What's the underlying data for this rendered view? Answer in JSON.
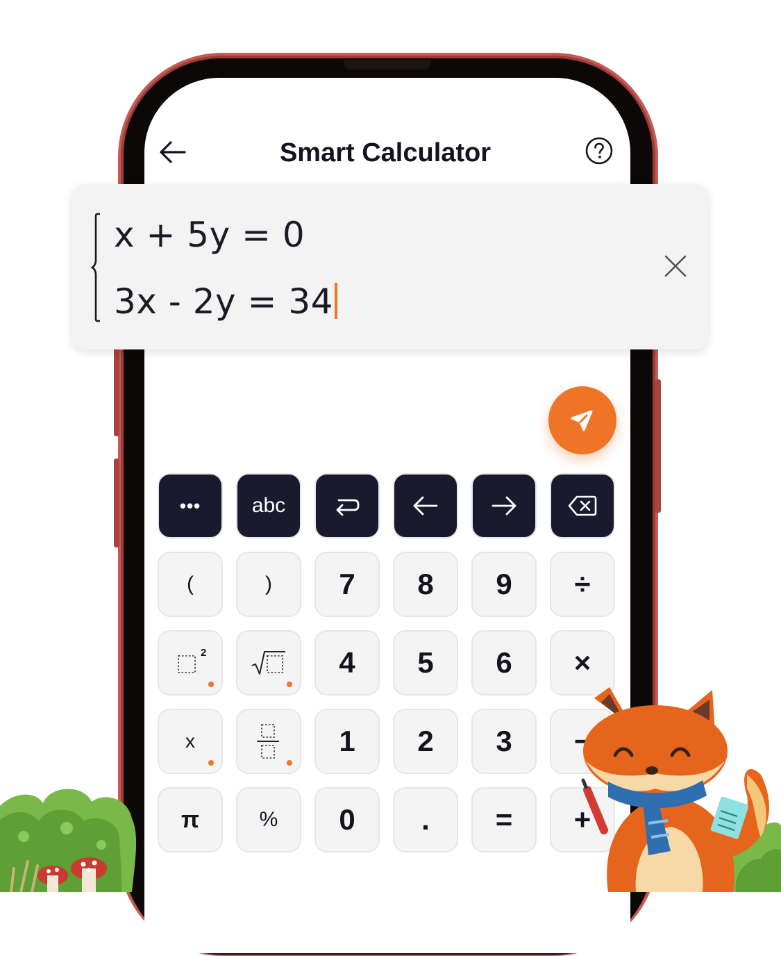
{
  "app": {
    "title": "Smart Calculator"
  },
  "input": {
    "equations": [
      "x + 5y = 0",
      "3x - 2y = 34"
    ]
  },
  "keypad": {
    "toolbar": [
      {
        "name": "more-key",
        "label": "•••"
      },
      {
        "name": "abc-key",
        "label": "abc"
      },
      {
        "name": "enter-key",
        "label": ""
      },
      {
        "name": "cursor-left-key",
        "label": ""
      },
      {
        "name": "cursor-right-key",
        "label": ""
      },
      {
        "name": "backspace-key",
        "label": ""
      }
    ],
    "row1": [
      "(",
      ")",
      "7",
      "8",
      "9",
      "÷"
    ],
    "row2": [
      "",
      "",
      "4",
      "5",
      "6",
      "×"
    ],
    "row3": [
      "x",
      "",
      "1",
      "2",
      "3",
      "−"
    ],
    "row4": [
      "π",
      "%",
      "0",
      ".",
      "=",
      "+"
    ],
    "square_key_exponent": "2"
  },
  "colors": {
    "accent": "#f07427",
    "dark_key": "#1a1a2e",
    "light_key": "#f4f4f4",
    "phone_frame": "#c25a55"
  }
}
